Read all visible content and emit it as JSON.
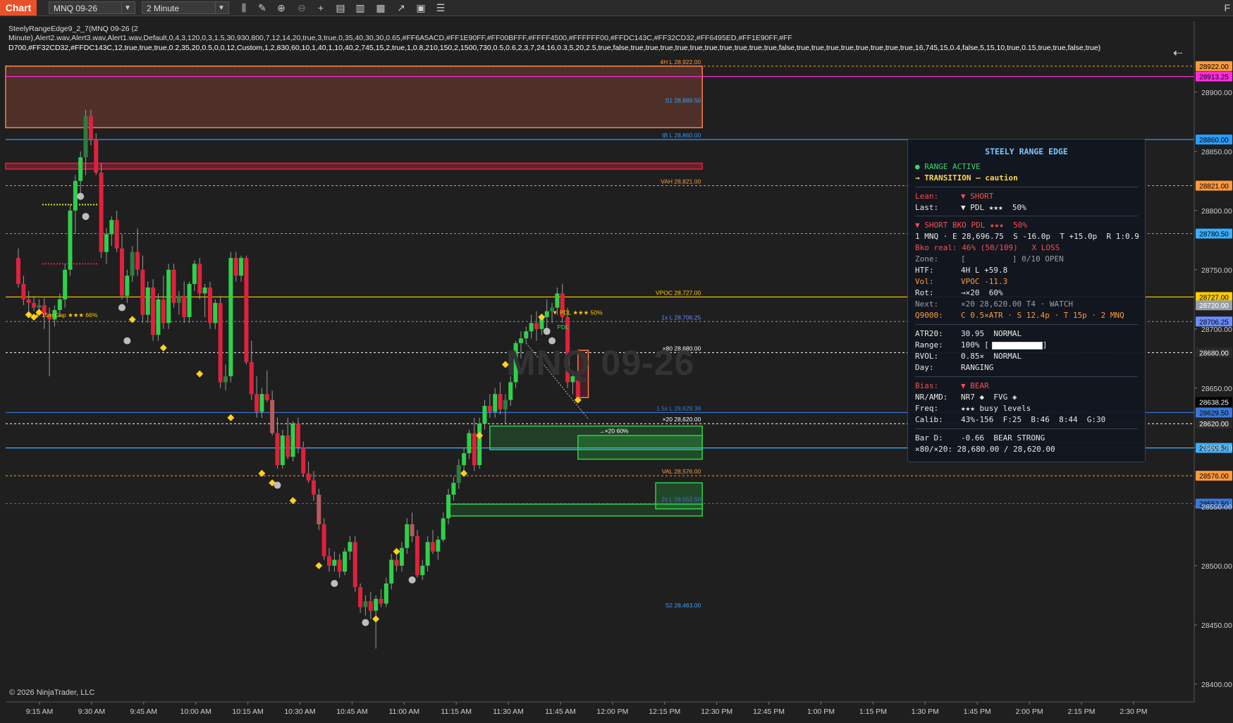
{
  "toolbar": {
    "tab_label": "Chart",
    "instrument": "MNQ 09-26",
    "interval": "2 Minute",
    "corner": "F"
  },
  "indicator": {
    "label": "SteelyRangeEdge9_2_7(MNQ 09-26 (2",
    "params_line1": "Minute),Alert2.wav,Alert3.wav,Alert1.wav,Default,0,4,3,120,0,3,1,5,30,930,800,7,12,14,20,true,3,true,0,35,40,30,30,0.65,#FF6A5ACD,#FF1E90FF,#FF00BFFF,#FFFF4500,#FFFFFF00,#FFDC143C,#FF32CD32,#FF6495ED,#FF1E90FF,#FF",
    "params_line2": "D700,#FF32CD32,#FFDC143C,12,true,true,true,0.2,35,20,0.5,0,0,12,Custom,1,2,830,60,10,1,40,1,10,40,2,745,15,2,true,1,0.8,210,150,2,1500,730,0.5,0.6,2,3,7,24,16,0.3,5,20,2.5,true,false,true,true,true,true,true,true,true,true,true,true,false,true,true,true,true,true,true,true,true,16,745,15,0.4,false,5,15,10,true,0.15,true,true,false,true)"
  },
  "watermark": "MNQ 09-26",
  "copyright": "© 2026 NinjaTrader, LLC",
  "colors": {
    "bull": "#2ed14a",
    "bear": "#e0213c",
    "bull_faded": "#2e7d3d",
    "bear_faded": "#b85b5e",
    "neutral": "#8a8a8a",
    "accent": "#e8512a"
  },
  "chart_data": {
    "type": "candlestick",
    "instrument": "MNQ 09-26",
    "interval": "2 Minute",
    "ylim": [
      28385,
      28960
    ],
    "y_ticks": [
      28400,
      28450,
      28500,
      28550,
      28600,
      28650,
      28700,
      28750,
      28800,
      28850,
      28900
    ],
    "y_tick_labels": [
      "28400.00",
      "28450.00",
      "28500.00",
      "28550.00",
      "28600.00",
      "28650.00",
      "28700.00",
      "28750.00",
      "28800.00",
      "28850.00",
      "28900.00"
    ],
    "x_tick_labels": [
      "9:15 AM",
      "9:30 AM",
      "9:45 AM",
      "10:00 AM",
      "10:15 AM",
      "10:30 AM",
      "10:45 AM",
      "11:00 AM",
      "11:15 AM",
      "11:30 AM",
      "11:45 AM",
      "12:00 PM",
      "12:15 PM",
      "12:30 PM",
      "12:45 PM",
      "1:00 PM",
      "1:15 PM",
      "1:30 PM",
      "1:45 PM",
      "2:00 PM",
      "2:15 PM",
      "2:30 PM"
    ],
    "levels": [
      {
        "text": "4H L",
        "value_text": "28,922.00",
        "price": 28922,
        "color": "#ff9a3c",
        "style": "dash",
        "tag": "28922.00"
      },
      {
        "text": "",
        "value_text": "",
        "price": 28913.25,
        "color": "#ff2de0",
        "style": "solid",
        "tag": "28913.25"
      },
      {
        "text": "S1",
        "value_text": "28,889.50",
        "price": 28889.5,
        "color": "#3aa0ff",
        "style": "none",
        "tag": ""
      },
      {
        "text": "IB L",
        "value_text": "28,860.00",
        "price": 28860,
        "color": "#2a9dff",
        "style": "solid",
        "tag": "28860.00"
      },
      {
        "text": "VAH",
        "value_text": "28,821.00",
        "price": 28821,
        "color": "#ff9a3c",
        "style": "dash",
        "tag": "28821.00"
      },
      {
        "text": "",
        "value_text": "",
        "price": 28780.5,
        "color": "#3ab0ff",
        "style": "dash",
        "tag": "28780.50"
      },
      {
        "text": "VPOC",
        "value_text": "28,727.00",
        "price": 28727,
        "color": "#ffcc00",
        "style": "solid",
        "tag": "28727.00"
      },
      {
        "text": "",
        "value_text": "",
        "price": 28720,
        "color": "#9aa0aa",
        "style": "none",
        "tag": "28720.00"
      },
      {
        "text": "1x L",
        "value_text": "28,706.25",
        "price": 28706.25,
        "color": "#6a8cff",
        "style": "dash",
        "tag": "28706.25"
      },
      {
        "text": "×80",
        "value_text": "28,680.00",
        "price": 28680,
        "color": "#ffffff",
        "style": "dash",
        "tag": "28680.00"
      },
      {
        "text": "",
        "value_text": "",
        "price": 28638.25,
        "color": "#000000",
        "style": "none",
        "tag": "28638.25"
      },
      {
        "text": "1.5x L",
        "value_text": "28,629.38",
        "price": 28629.38,
        "color": "#3a78d8",
        "style": "solid",
        "tag": "28629.50"
      },
      {
        "text": "×20",
        "value_text": "28,620.00",
        "price": 28620,
        "color": "#ffffff",
        "style": "dash",
        "tag": "28620.00"
      },
      {
        "text": "",
        "value_text": "",
        "price": 28599.5,
        "color": "#3ab0ff",
        "style": "solid",
        "tag": "28599.50"
      },
      {
        "text": "VAL",
        "value_text": "28,576.00",
        "price": 28576,
        "color": "#ff9a3c",
        "style": "dash",
        "tag": "28576.00"
      },
      {
        "text": "2x L",
        "value_text": "28,552.50",
        "price": 28552.5,
        "color": "#3a78d8",
        "style": "dash",
        "tag": "28552.50"
      },
      {
        "text": "S2",
        "value_text": "28,463.00",
        "price": 28463,
        "color": "#3aa0ff",
        "style": "none",
        "tag": ""
      }
    ],
    "annotations": [
      {
        "text": "▲ 15m Gap ★★★ 66%",
        "x_index": 3,
        "price": 28710,
        "color": "#ffcc00"
      },
      {
        "text": "→×20 60%",
        "x_index": 112,
        "price": 28612,
        "color": "#ffffff"
      },
      {
        "text": "▼ PDL ★★★ 50%",
        "x_index": 103,
        "price": 28712,
        "color": "#ffcc00"
      },
      {
        "text": "PDL",
        "x_index": 104,
        "price": 28700,
        "color": "#3fd46b"
      }
    ],
    "candles": [
      {
        "o": 28760,
        "h": 28768,
        "l": 28735,
        "c": 28738
      },
      {
        "o": 28738,
        "h": 28745,
        "l": 28720,
        "c": 28725
      },
      {
        "o": 28725,
        "h": 28732,
        "l": 28712,
        "c": 28722
      },
      {
        "o": 28722,
        "h": 28728,
        "l": 28715,
        "c": 28718
      },
      {
        "o": 28718,
        "h": 28725,
        "l": 28712,
        "c": 28720
      },
      {
        "o": 28720,
        "h": 28726,
        "l": 28700,
        "c": 28712
      },
      {
        "o": 28712,
        "h": 28718,
        "l": 28660,
        "c": 28708
      },
      {
        "o": 28708,
        "h": 28720,
        "l": 28702,
        "c": 28716
      },
      {
        "o": 28716,
        "h": 28730,
        "l": 28710,
        "c": 28725
      },
      {
        "o": 28725,
        "h": 28755,
        "l": 28718,
        "c": 28750
      },
      {
        "o": 28750,
        "h": 28805,
        "l": 28745,
        "c": 28800
      },
      {
        "o": 28800,
        "h": 28830,
        "l": 28780,
        "c": 28825
      },
      {
        "o": 28825,
        "h": 28850,
        "l": 28810,
        "c": 28845
      },
      {
        "o": 28845,
        "h": 28885,
        "l": 28830,
        "c": 28880
      },
      {
        "o": 28880,
        "h": 28885,
        "l": 28855,
        "c": 28860
      },
      {
        "o": 28860,
        "h": 28865,
        "l": 28830,
        "c": 28832
      },
      {
        "o": 28832,
        "h": 28840,
        "l": 28760,
        "c": 28765
      },
      {
        "o": 28765,
        "h": 28785,
        "l": 28755,
        "c": 28780
      },
      {
        "o": 28780,
        "h": 28795,
        "l": 28770,
        "c": 28792
      },
      {
        "o": 28792,
        "h": 28800,
        "l": 28765,
        "c": 28768
      },
      {
        "o": 28768,
        "h": 28780,
        "l": 28725,
        "c": 28728
      },
      {
        "o": 28728,
        "h": 28750,
        "l": 28722,
        "c": 28745
      },
      {
        "o": 28745,
        "h": 28770,
        "l": 28740,
        "c": 28765
      },
      {
        "o": 28765,
        "h": 28785,
        "l": 28745,
        "c": 28750
      },
      {
        "o": 28750,
        "h": 28762,
        "l": 28705,
        "c": 28712
      },
      {
        "o": 28712,
        "h": 28740,
        "l": 28705,
        "c": 28735
      },
      {
        "o": 28735,
        "h": 28742,
        "l": 28690,
        "c": 28695
      },
      {
        "o": 28695,
        "h": 28730,
        "l": 28690,
        "c": 28725
      },
      {
        "o": 28725,
        "h": 28745,
        "l": 28700,
        "c": 28705
      },
      {
        "o": 28705,
        "h": 28755,
        "l": 28700,
        "c": 28750
      },
      {
        "o": 28750,
        "h": 28755,
        "l": 28718,
        "c": 28722
      },
      {
        "o": 28722,
        "h": 28732,
        "l": 28712,
        "c": 28728
      },
      {
        "o": 28728,
        "h": 28740,
        "l": 28705,
        "c": 28710
      },
      {
        "o": 28710,
        "h": 28740,
        "l": 28705,
        "c": 28738
      },
      {
        "o": 28738,
        "h": 28758,
        "l": 28732,
        "c": 28755
      },
      {
        "o": 28755,
        "h": 28760,
        "l": 28725,
        "c": 28730
      },
      {
        "o": 28730,
        "h": 28738,
        "l": 28710,
        "c": 28735
      },
      {
        "o": 28735,
        "h": 28740,
        "l": 28700,
        "c": 28705
      },
      {
        "o": 28705,
        "h": 28725,
        "l": 28700,
        "c": 28722
      },
      {
        "o": 28722,
        "h": 28728,
        "l": 28650,
        "c": 28655
      },
      {
        "o": 28655,
        "h": 28670,
        "l": 28648,
        "c": 28660
      },
      {
        "o": 28660,
        "h": 28765,
        "l": 28655,
        "c": 28760
      },
      {
        "o": 28760,
        "h": 28765,
        "l": 28740,
        "c": 28745
      },
      {
        "o": 28745,
        "h": 28762,
        "l": 28740,
        "c": 28760
      },
      {
        "o": 28760,
        "h": 28762,
        "l": 28670,
        "c": 28672
      },
      {
        "o": 28672,
        "h": 28690,
        "l": 28640,
        "c": 28645
      },
      {
        "o": 28645,
        "h": 28660,
        "l": 28625,
        "c": 28630
      },
      {
        "o": 28630,
        "h": 28650,
        "l": 28625,
        "c": 28645
      },
      {
        "o": 28645,
        "h": 28665,
        "l": 28638,
        "c": 28640
      },
      {
        "o": 28640,
        "h": 28648,
        "l": 28610,
        "c": 28612
      },
      {
        "o": 28612,
        "h": 28625,
        "l": 28582,
        "c": 28585
      },
      {
        "o": 28585,
        "h": 28615,
        "l": 28582,
        "c": 28610
      },
      {
        "o": 28610,
        "h": 28625,
        "l": 28590,
        "c": 28592
      },
      {
        "o": 28592,
        "h": 28622,
        "l": 28588,
        "c": 28620
      },
      {
        "o": 28620,
        "h": 28625,
        "l": 28595,
        "c": 28600
      },
      {
        "o": 28600,
        "h": 28605,
        "l": 28575,
        "c": 28578
      },
      {
        "o": 28578,
        "h": 28588,
        "l": 28570,
        "c": 28572
      },
      {
        "o": 28572,
        "h": 28580,
        "l": 28555,
        "c": 28560
      },
      {
        "o": 28560,
        "h": 28565,
        "l": 28530,
        "c": 28535
      },
      {
        "o": 28535,
        "h": 28540,
        "l": 28505,
        "c": 28508
      },
      {
        "o": 28508,
        "h": 28515,
        "l": 28495,
        "c": 28500
      },
      {
        "o": 28500,
        "h": 28512,
        "l": 28495,
        "c": 28505
      },
      {
        "o": 28505,
        "h": 28510,
        "l": 28490,
        "c": 28495
      },
      {
        "o": 28495,
        "h": 28515,
        "l": 28492,
        "c": 28512
      },
      {
        "o": 28512,
        "h": 28525,
        "l": 28505,
        "c": 28520
      },
      {
        "o": 28520,
        "h": 28525,
        "l": 28478,
        "c": 28482
      },
      {
        "o": 28482,
        "h": 28485,
        "l": 28460,
        "c": 28465
      },
      {
        "o": 28465,
        "h": 28475,
        "l": 28458,
        "c": 28470
      },
      {
        "o": 28470,
        "h": 28478,
        "l": 28455,
        "c": 28462
      },
      {
        "o": 28462,
        "h": 28475,
        "l": 28430,
        "c": 28472
      },
      {
        "o": 28472,
        "h": 28480,
        "l": 28465,
        "c": 28468
      },
      {
        "o": 28468,
        "h": 28490,
        "l": 28465,
        "c": 28485
      },
      {
        "o": 28485,
        "h": 28510,
        "l": 28480,
        "c": 28505
      },
      {
        "o": 28505,
        "h": 28515,
        "l": 28495,
        "c": 28500
      },
      {
        "o": 28500,
        "h": 28520,
        "l": 28495,
        "c": 28515
      },
      {
        "o": 28515,
        "h": 28540,
        "l": 28510,
        "c": 28535
      },
      {
        "o": 28535,
        "h": 28545,
        "l": 28520,
        "c": 28525
      },
      {
        "o": 28525,
        "h": 28530,
        "l": 28490,
        "c": 28492
      },
      {
        "o": 28492,
        "h": 28505,
        "l": 28488,
        "c": 28500
      },
      {
        "o": 28500,
        "h": 28525,
        "l": 28495,
        "c": 28520
      },
      {
        "o": 28520,
        "h": 28530,
        "l": 28510,
        "c": 28512
      },
      {
        "o": 28512,
        "h": 28525,
        "l": 28505,
        "c": 28522
      },
      {
        "o": 28522,
        "h": 28545,
        "l": 28520,
        "c": 28540
      },
      {
        "o": 28540,
        "h": 28565,
        "l": 28535,
        "c": 28560
      },
      {
        "o": 28560,
        "h": 28575,
        "l": 28555,
        "c": 28570
      },
      {
        "o": 28570,
        "h": 28590,
        "l": 28565,
        "c": 28585
      },
      {
        "o": 28585,
        "h": 28600,
        "l": 28580,
        "c": 28595
      },
      {
        "o": 28595,
        "h": 28615,
        "l": 28590,
        "c": 28612
      },
      {
        "o": 28612,
        "h": 28625,
        "l": 28580,
        "c": 28585
      },
      {
        "o": 28585,
        "h": 28625,
        "l": 28582,
        "c": 28620
      },
      {
        "o": 28620,
        "h": 28640,
        "l": 28615,
        "c": 28635
      },
      {
        "o": 28635,
        "h": 28645,
        "l": 28625,
        "c": 28630
      },
      {
        "o": 28630,
        "h": 28650,
        "l": 28625,
        "c": 28645
      },
      {
        "o": 28645,
        "h": 28655,
        "l": 28628,
        "c": 28632
      },
      {
        "o": 28632,
        "h": 28645,
        "l": 28620,
        "c": 28640
      },
      {
        "o": 28640,
        "h": 28660,
        "l": 28635,
        "c": 28655
      },
      {
        "o": 28655,
        "h": 28690,
        "l": 28650,
        "c": 28688
      },
      {
        "o": 28688,
        "h": 28698,
        "l": 28675,
        "c": 28692
      },
      {
        "o": 28692,
        "h": 28702,
        "l": 28688,
        "c": 28698
      },
      {
        "o": 28698,
        "h": 28712,
        "l": 28692,
        "c": 28705
      },
      {
        "o": 28705,
        "h": 28715,
        "l": 28690,
        "c": 28700
      },
      {
        "o": 28700,
        "h": 28712,
        "l": 28695,
        "c": 28710
      },
      {
        "o": 28710,
        "h": 28725,
        "l": 28700,
        "c": 28715
      },
      {
        "o": 28715,
        "h": 28722,
        "l": 28705,
        "c": 28718
      },
      {
        "o": 28718,
        "h": 28735,
        "l": 28712,
        "c": 28730
      },
      {
        "o": 28730,
        "h": 28738,
        "l": 28705,
        "c": 28710
      },
      {
        "o": 28710,
        "h": 28718,
        "l": 28650,
        "c": 28655
      },
      {
        "o": 28655,
        "h": 28665,
        "l": 28645,
        "c": 28660
      },
      {
        "o": 28660,
        "h": 28662,
        "l": 28638,
        "c": 28640
      }
    ],
    "dots": [
      {
        "i": 2,
        "p": 28712,
        "kind": "diamond"
      },
      {
        "i": 3,
        "p": 28710,
        "kind": "diamond"
      },
      {
        "i": 4,
        "p": 28714,
        "kind": "diamond"
      },
      {
        "i": 12,
        "p": 28812,
        "kind": "circle"
      },
      {
        "i": 13,
        "p": 28795,
        "kind": "circle"
      },
      {
        "i": 20,
        "p": 28718,
        "kind": "circle"
      },
      {
        "i": 21,
        "p": 28690,
        "kind": "circle"
      },
      {
        "i": 22,
        "p": 28708,
        "kind": "diamond"
      },
      {
        "i": 28,
        "p": 28684,
        "kind": "diamond"
      },
      {
        "i": 35,
        "p": 28662,
        "kind": "diamond"
      },
      {
        "i": 41,
        "p": 28625,
        "kind": "diamond"
      },
      {
        "i": 47,
        "p": 28578,
        "kind": "diamond"
      },
      {
        "i": 49,
        "p": 28570,
        "kind": "diamond"
      },
      {
        "i": 50,
        "p": 28568,
        "kind": "circle"
      },
      {
        "i": 53,
        "p": 28555,
        "kind": "diamond"
      },
      {
        "i": 58,
        "p": 28500,
        "kind": "diamond"
      },
      {
        "i": 61,
        "p": 28485,
        "kind": "circle"
      },
      {
        "i": 67,
        "p": 28452,
        "kind": "circle"
      },
      {
        "i": 69,
        "p": 28455,
        "kind": "diamond"
      },
      {
        "i": 73,
        "p": 28512,
        "kind": "diamond"
      },
      {
        "i": 76,
        "p": 28488,
        "kind": "circle"
      },
      {
        "i": 86,
        "p": 28578,
        "kind": "diamond"
      },
      {
        "i": 89,
        "p": 28610,
        "kind": "diamond"
      },
      {
        "i": 94,
        "p": 28670,
        "kind": "diamond"
      },
      {
        "i": 101,
        "p": 28710,
        "kind": "diamond"
      },
      {
        "i": 102,
        "p": 28698,
        "kind": "circle"
      },
      {
        "i": 103,
        "p": 28690,
        "kind": "circle"
      },
      {
        "i": 108,
        "p": 28640,
        "kind": "diamond"
      }
    ]
  },
  "panel": {
    "title": "STEELY RANGE EDGE",
    "status1": "● RANGE ACTIVE",
    "status2": "→ TRANSITION — caution",
    "lean_k": "Lean:",
    "lean_v": "▼ SHORT",
    "last_k": "Last:",
    "last_v": "▼ PDL ★★★  50%",
    "signal": "▼ SHORT BKO PDL ★★★  50%",
    "order": "1 MNQ · E 28,696.75  S -16.0p  T +15.0p  R 1:0.9",
    "bko": "Bko real: 46% (50/109)   X LOSS",
    "zone_k": "Zone:",
    "zone_v": "[          ] 0/10 OPEN",
    "htf_k": "HTF:",
    "htf_v": "4H L +59.8",
    "vol_k": "Vol:",
    "vol_v": "VPOC -11.3",
    "rot_k": "Rot:",
    "rot_v": "→×20  60%",
    "next_k": "Next:",
    "next_v": "×20 28,620.00 T4 · WATCH",
    "q_k": "Q9000:",
    "q_v": "C 0.5×ATR · S 12.4p · T 15p · 2 MNQ",
    "atr_k": "ATR20:",
    "atr_v": "30.95  NORMAL",
    "range_k": "Range:",
    "range_v": "100%",
    "range_fill": 1.0,
    "rvol_k": "RVOL:",
    "rvol_v": "0.85×  NORMAL",
    "day_k": "Day:",
    "day_v": "RANGING",
    "bias_k": "Bias:",
    "bias_v": "▼ BEAR",
    "nr_k": "NR/AMD:",
    "nr_v": "NR7 ◆  FVG ◈",
    "freq_k": "Freq:",
    "freq_v": "★★★ busy levels",
    "calib_k": "Calib:",
    "calib_v": "43%-156  F:25  B:46  8:44  G:30",
    "bard_k": "Bar D:",
    "bard_v": "-0.66  BEAR STRONG",
    "x80": "×80/×20: 28,680.00 / 28,620.00"
  }
}
